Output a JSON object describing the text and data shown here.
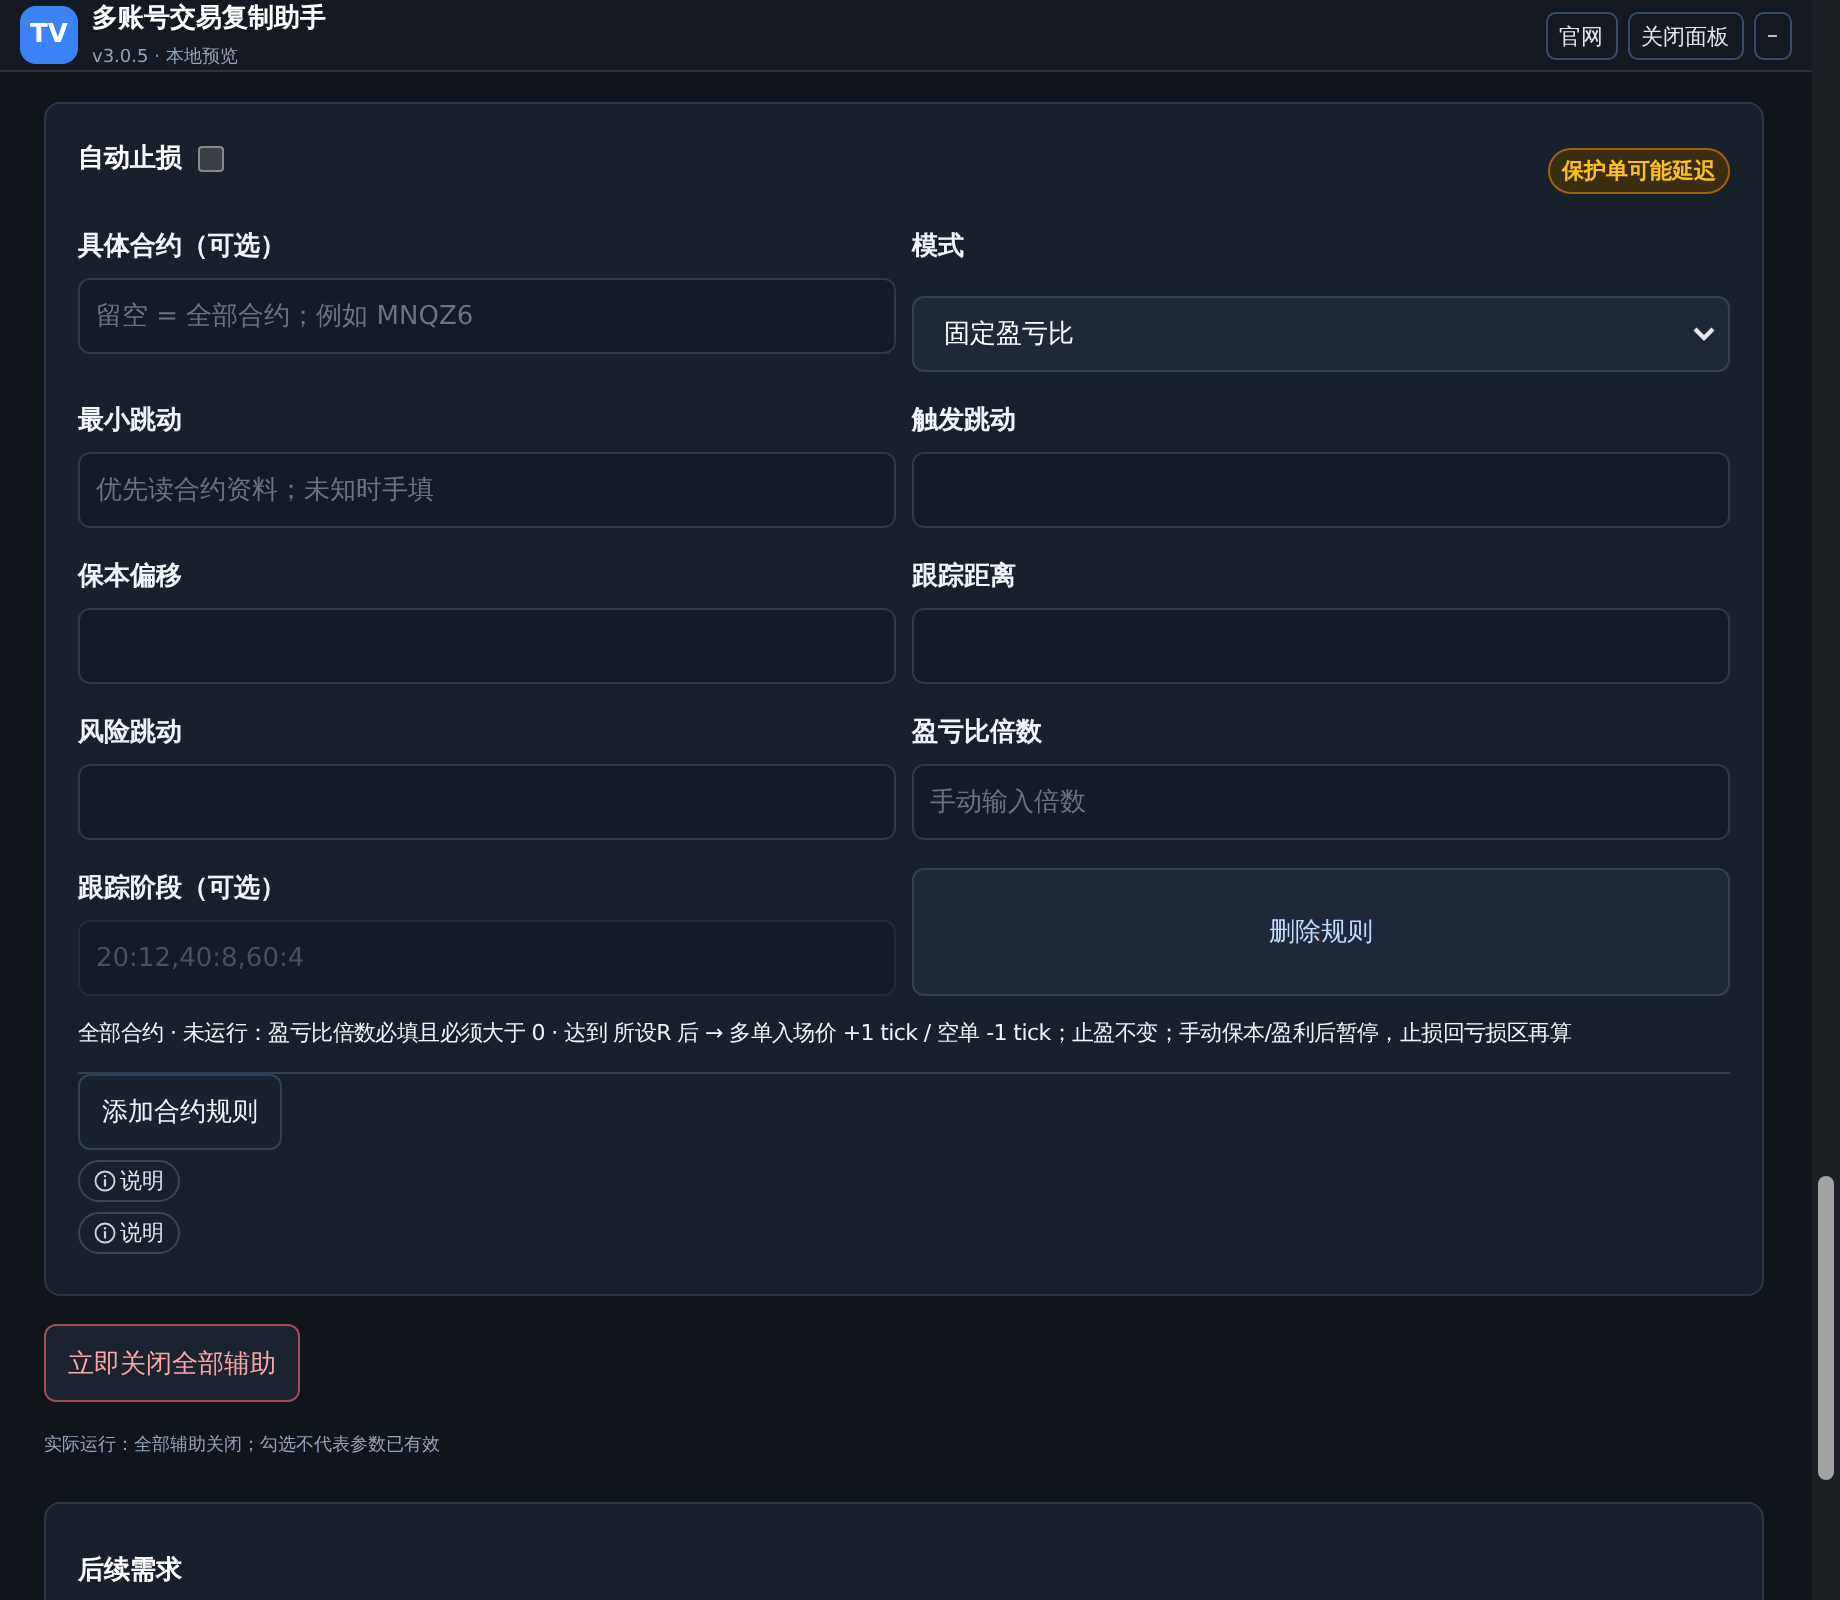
{
  "header": {
    "logo": "TV",
    "title": "多账号交易复制助手",
    "subtitle": "v3.0.5 · 本地预览",
    "buttons": [
      "官网",
      "关闭面板",
      "–"
    ]
  },
  "card": {
    "title": "自动止损",
    "checked": false,
    "badge": "保护单可能延迟",
    "fields": [
      {
        "kind": "input",
        "label": "具体合约（可选）",
        "placeholder": "留空 = 全部合约；例如 MNQZ6",
        "disabled": false
      },
      {
        "kind": "select",
        "label": "模式",
        "value": "固定盈亏比"
      },
      {
        "kind": "input",
        "label": "最小跳动",
        "placeholder": "优先读合约资料；未知时手填",
        "disabled": false
      },
      {
        "kind": "input",
        "label": "触发跳动",
        "disabled": false
      },
      {
        "kind": "input",
        "label": "保本偏移",
        "disabled": false
      },
      {
        "kind": "input",
        "label": "跟踪距离",
        "disabled": false
      },
      {
        "kind": "input",
        "label": "风险跳动",
        "disabled": false
      },
      {
        "kind": "input",
        "label": "盈亏比倍数",
        "placeholder": "手动输入倍数",
        "disabled": false
      },
      {
        "kind": "input",
        "label": "跟踪阶段（可选）",
        "placeholder": "20:12,40:8,60:4",
        "disabled": true
      },
      {
        "kind": "button",
        "label": "删除规则"
      }
    ],
    "summary": "全部合约 · 未运行：盈亏比倍数必填且必须大于 0 · 达到 所设R 后 → 多单入场价 +1 tick / 空单 -1 tick；止盈不变；手动保本/盈利后暂停，止损回亏损区再算",
    "add_button": "添加合约规则",
    "help_buttons": [
      "说明",
      "说明"
    ]
  },
  "danger_button": "立即关闭全部辅助",
  "note": "实际运行：全部辅助关闭；勾选不代表参数已有效",
  "next_card": {
    "title": "后续需求"
  }
}
